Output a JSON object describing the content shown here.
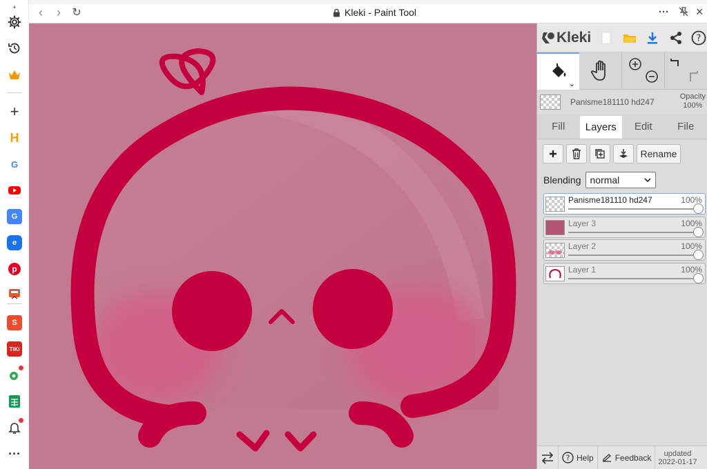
{
  "window": {
    "title": "Kleki - Paint Tool",
    "nav": {
      "back": "‹",
      "forward": "›",
      "reload": "↻"
    },
    "more": "···",
    "close": "×"
  },
  "dock": {
    "items": [
      "settings-icon",
      "history-icon",
      "crown-icon",
      "add-icon",
      "hamburger-h-app",
      "google-app",
      "youtube-app",
      "translate-app",
      "edge-app",
      "pinterest-app",
      "download-app",
      "shopee-app",
      "tiki-app",
      "location-app",
      "sheets-app",
      "bell-icon",
      "more-icon"
    ],
    "tile_labels": {
      "h": "H",
      "g": "G",
      "tiki": "TIKI"
    },
    "more": "···"
  },
  "kleki": {
    "logo": "Kleki",
    "layer_name": "Panisme181110 hd247",
    "opacity_label": "Opacity",
    "opacity_value": "100%",
    "tabs": [
      "Fill",
      "Layers",
      "Edit",
      "File"
    ],
    "active_tab": "Layers",
    "rename": "Rename",
    "blending_label": "Blending",
    "blending_value": "normal",
    "layers": [
      {
        "name": "Panisme181110 hd247",
        "opacity": "100%",
        "active": true
      },
      {
        "name": "Layer 3",
        "opacity": "100%",
        "active": false
      },
      {
        "name": "Layer 2",
        "opacity": "100%",
        "active": false
      },
      {
        "name": "Layer 1",
        "opacity": "100%",
        "active": false
      }
    ],
    "footer": {
      "help": "Help",
      "feedback": "Feedback",
      "updated_label": "updated",
      "updated_date": "2022-01-17"
    }
  },
  "colors": {
    "canvas_bg": "#c27a91",
    "ink": "#c4003f",
    "blush": "#d96088",
    "accent_blue": "#1a73e8"
  }
}
